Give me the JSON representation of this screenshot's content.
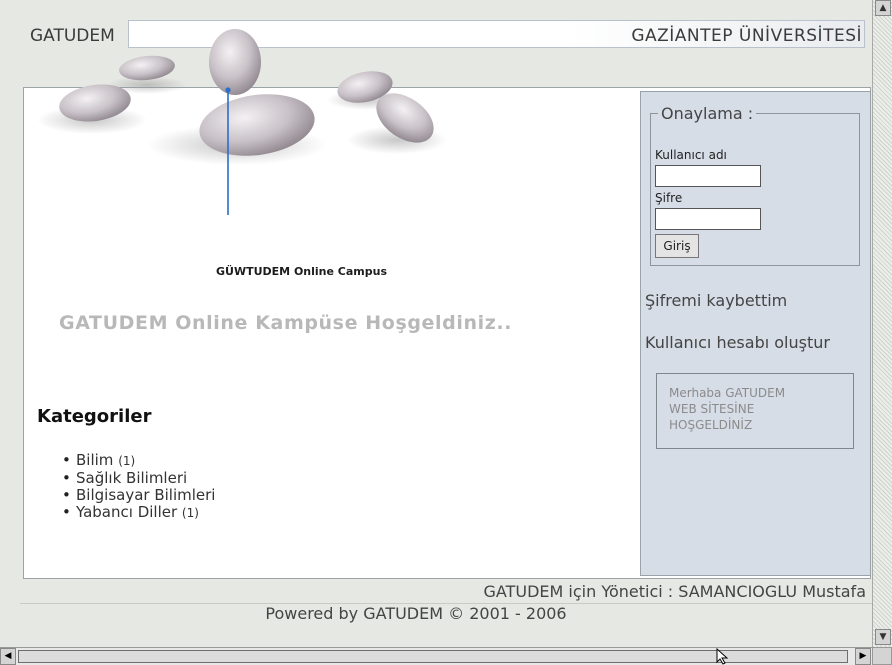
{
  "header": {
    "left_label": "GATUDEM",
    "right_label": "GAZİANTEP ÜNİVERSİTESİ"
  },
  "hero": {
    "caption": "GÜWTUDEM Online Campus",
    "welcome": "GATUDEM Online Kampüse Hoşgeldiniz.."
  },
  "categories": {
    "title": "Kategoriler",
    "items": [
      {
        "label": "Bilim",
        "count": "(1)"
      },
      {
        "label": "Sağlık Bilimleri",
        "count": ""
      },
      {
        "label": "Bilgisayar Bilimleri",
        "count": ""
      },
      {
        "label": "Yabancı Diller",
        "count": "(1)"
      }
    ]
  },
  "login": {
    "legend": "Onaylama :",
    "username_label": "Kullanıcı adı",
    "username_value": "",
    "password_label": "Şifre",
    "password_value": "",
    "submit_label": "Giriş"
  },
  "sidebar": {
    "forgot_password": "Şifremi kaybettim",
    "create_account": "Kullanıcı hesabı oluştur",
    "greeting_lines": [
      "Merhaba GATUDEM",
      "WEB SİTESİNE",
      "HOŞGELDİNİZ"
    ]
  },
  "footer": {
    "admin_line": "GATUDEM için Yönetici : SAMANCIOGLU Mustafa",
    "powered_prefix": "Powered by",
    "powered_brand": "GATUDEM",
    "copyright": "© 2001 - 2006"
  },
  "colors": {
    "sidebar_bg": "#d6dde6",
    "welcome_text": "#b8b8b8",
    "hero_marker": "#2a6fc9"
  }
}
